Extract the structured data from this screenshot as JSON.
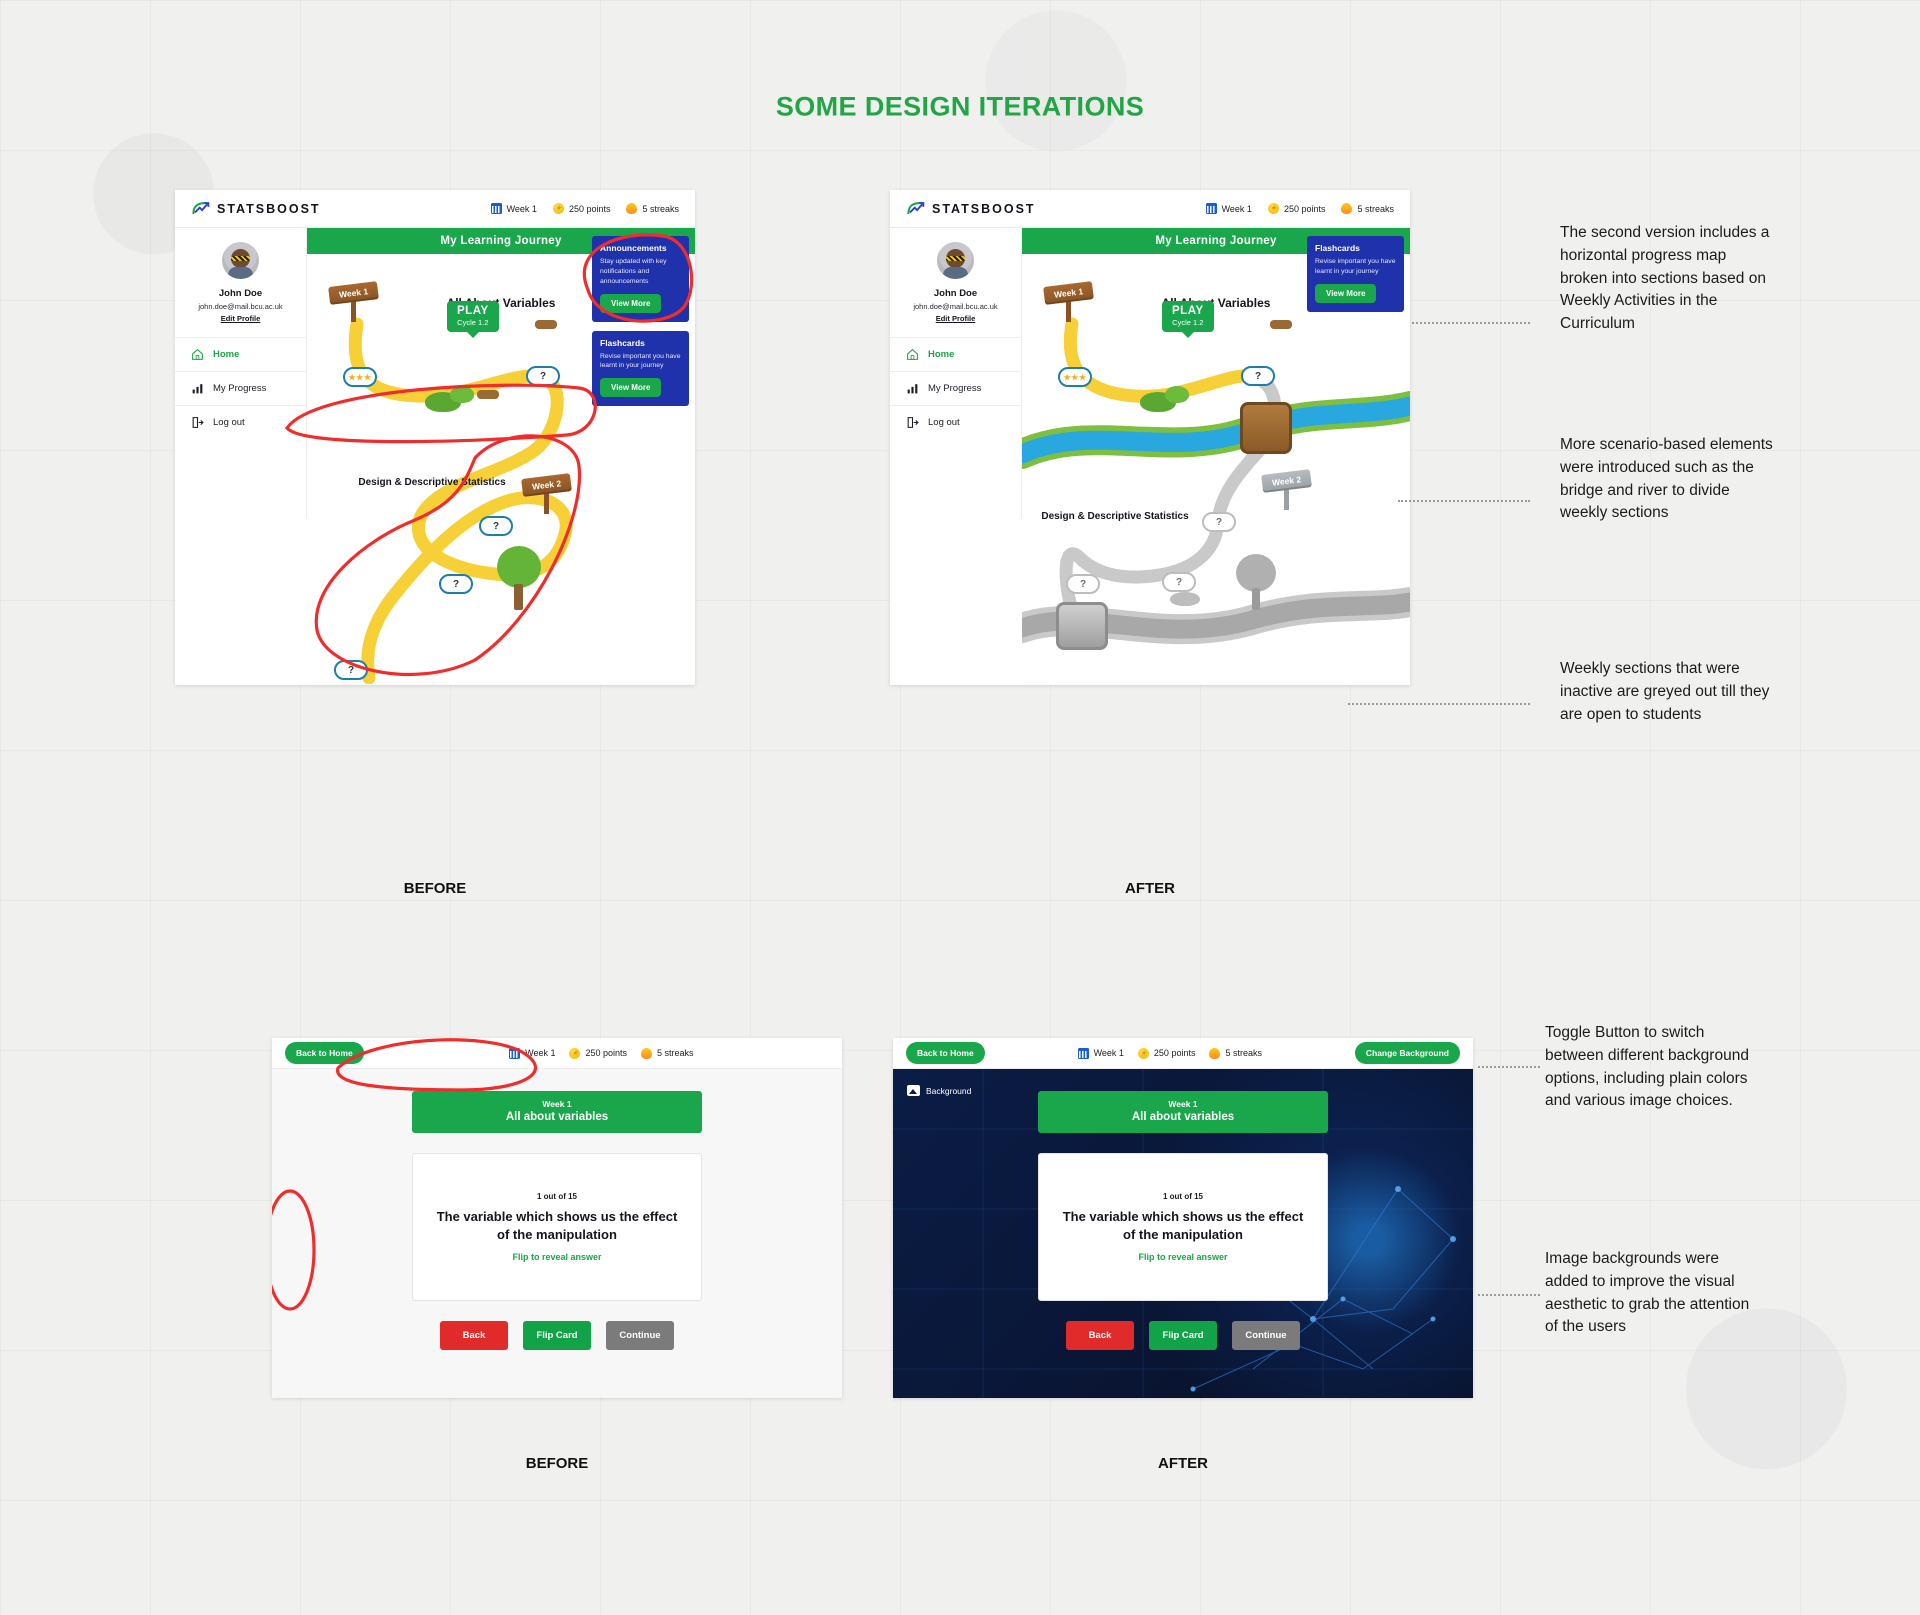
{
  "page": {
    "title": "SOME DESIGN ITERATIONS",
    "accent_green": "#22a545",
    "brand_blue": "#1f31ab",
    "annotate_red": "#ef2d2d"
  },
  "app": {
    "brand": "STATSBOOST",
    "badges": [
      {
        "icon": "calendar-icon",
        "label": "Week 1"
      },
      {
        "icon": "coin-icon",
        "label": "250 points"
      },
      {
        "icon": "fire-icon",
        "label": "5 streaks"
      }
    ],
    "sidebar": {
      "user_name": "John Doe",
      "user_email": "john.doe@mail.bcu.ac.uk",
      "edit_profile": "Edit Profile",
      "items": [
        {
          "icon": "home-icon",
          "label": "Home",
          "active": true
        },
        {
          "icon": "chart-icon",
          "label": "My Progress",
          "active": false
        },
        {
          "icon": "logout-icon",
          "label": "Log out",
          "active": false
        }
      ]
    },
    "journey_bar": "My Learning Journey",
    "map": {
      "week1_sign": "Week 1",
      "week2_sign": "Week 2",
      "title": "All About Variables",
      "section2_title": "Design & Descriptive Statistics",
      "play": {
        "label": "PLAY",
        "sub": "Cycle 1.2"
      },
      "node_question": "?",
      "node_stars": "★★★"
    },
    "cards": [
      {
        "title": "Announcements",
        "body": "Stay updated with key notifications and announcements",
        "cta": "View More"
      },
      {
        "title": "Flashcards",
        "body": "Revise important you have learnt in your journey",
        "cta": "View More"
      }
    ]
  },
  "flashcard": {
    "back_to_home": "Back to Home",
    "change_background": "Change Background",
    "background_label": "Background",
    "week_line1": "Week 1",
    "week_line2": "All about variables",
    "counter": "1 out of 15",
    "question": "The variable which shows us the effect of the manipulation",
    "flip_hint": "Flip to reveal answer",
    "buttons": [
      {
        "label": "Back",
        "color": "#e12b2b"
      },
      {
        "label": "Flip Card",
        "color": "#12a349"
      },
      {
        "label": "Continue",
        "color": "#7b7b7b"
      }
    ]
  },
  "captions": {
    "before_top": "BEFORE",
    "after_top": "AFTER",
    "before_bottom": "BEFORE",
    "after_bottom": "AFTER"
  },
  "annotations": [
    {
      "id": "anno-horizontal-map",
      "text": "The second version includes a horizontal progress map broken into sections based on Weekly Activities in the Curriculum"
    },
    {
      "id": "anno-scenario-elements",
      "text": "More scenario-based elements were introduced such as the bridge and river to divide weekly sections"
    },
    {
      "id": "anno-greyed-sections",
      "text": "Weekly sections that were inactive are greyed out till they are open to students"
    },
    {
      "id": "anno-toggle-background",
      "text": "Toggle Button to switch between different background options, including plain colors and various image choices."
    },
    {
      "id": "anno-image-backgrounds",
      "text": "Image backgrounds were added to improve the visual aesthetic to grab the attention of the users"
    }
  ]
}
